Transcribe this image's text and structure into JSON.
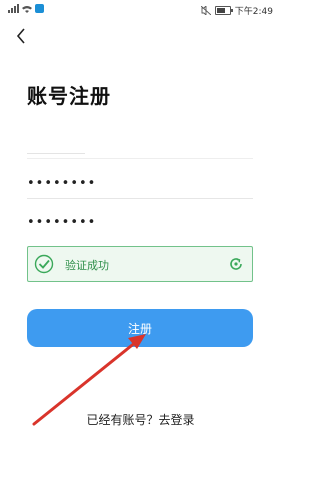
{
  "status_bar": {
    "time": "下午2:49",
    "icons": [
      "signal-icon",
      "wifi-icon",
      "app-notification-icon",
      "mute-icon",
      "battery-icon"
    ]
  },
  "nav": {
    "back_icon": "chevron-left-icon"
  },
  "page": {
    "title": "账号注册"
  },
  "form": {
    "phone_value": "",
    "password_value": "••••••••",
    "confirm_password_value": "••••••••"
  },
  "verification": {
    "status_text": "验证成功",
    "status_color": "#2f8f4a",
    "check_icon": "check-circle-icon",
    "refresh_icon": "refresh-icon"
  },
  "register_button": {
    "label": "注册",
    "color": "#3e9bf0"
  },
  "login_link": {
    "label": "已经有账号？去登录"
  },
  "annotation": {
    "color": "#d9342b"
  }
}
